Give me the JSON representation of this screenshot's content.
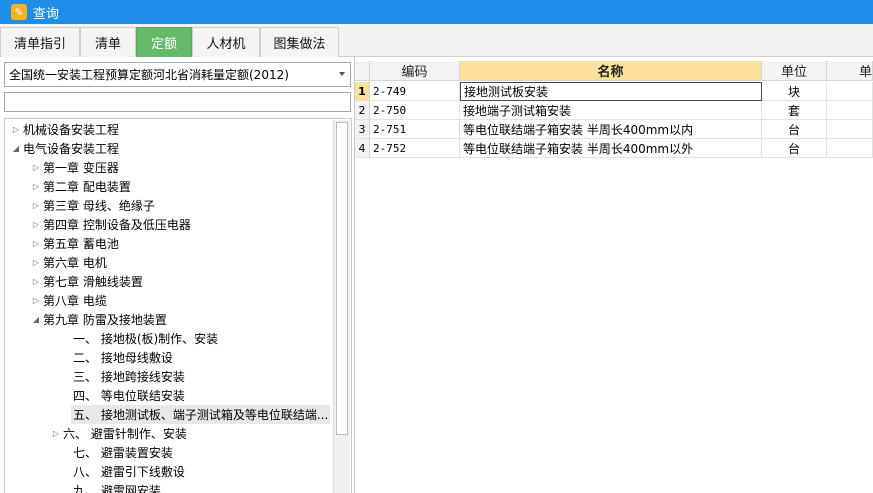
{
  "window": {
    "title": "查询"
  },
  "tabs": [
    {
      "label": "清单指引",
      "active": false
    },
    {
      "label": "清单",
      "active": false
    },
    {
      "label": "定额",
      "active": true
    },
    {
      "label": "人材机",
      "active": false
    },
    {
      "label": "图集做法",
      "active": false
    }
  ],
  "left_panel": {
    "quota_library": "全国统一安装工程预算定额河北省消耗量定额(2012)",
    "search_value": ""
  },
  "tree": [
    {
      "label": "机械设备安装工程",
      "state": "collapsed"
    },
    {
      "label": "电气设备安装工程",
      "state": "expanded"
    },
    {
      "label": "第一章 变压器",
      "state": "collapsed"
    },
    {
      "label": "第二章 配电装置",
      "state": "collapsed"
    },
    {
      "label": "第三章 母线、绝缘子",
      "state": "collapsed"
    },
    {
      "label": "第四章 控制设备及低压电器",
      "state": "collapsed"
    },
    {
      "label": "第五章 蓄电池",
      "state": "collapsed"
    },
    {
      "label": "第六章 电机",
      "state": "collapsed"
    },
    {
      "label": "第七章 滑触线装置",
      "state": "collapsed"
    },
    {
      "label": "第八章 电缆",
      "state": "collapsed"
    },
    {
      "label": "第九章 防雷及接地装置",
      "state": "expanded"
    },
    {
      "label": "一、 接地极(板)制作、安装",
      "state": "leaf"
    },
    {
      "label": "二、 接地母线敷设",
      "state": "leaf"
    },
    {
      "label": "三、 接地跨接线安装",
      "state": "leaf"
    },
    {
      "label": "四、 等电位联结安装",
      "state": "leaf"
    },
    {
      "label": "五、 接地测试板、端子测试箱及等电位联结端...",
      "state": "leaf",
      "selected": true
    },
    {
      "label": "六、 避雷针制作、安装",
      "state": "collapsed"
    },
    {
      "label": "七、 避雷装置安装",
      "state": "leaf"
    },
    {
      "label": "八、 避雷引下线敷设",
      "state": "leaf"
    },
    {
      "label": "九、 避雷网安装",
      "state": "leaf"
    }
  ],
  "grid": {
    "columns": [
      "编码",
      "名称",
      "单位",
      "单"
    ],
    "rows": [
      {
        "num": "1",
        "code": "2-749",
        "name": "接地测试板安装",
        "unit": "块"
      },
      {
        "num": "2",
        "code": "2-750",
        "name": "接地端子测试箱安装",
        "unit": "套"
      },
      {
        "num": "3",
        "code": "2-751",
        "name": "等电位联结端子箱安装 半周长400mm以内",
        "unit": "台"
      },
      {
        "num": "4",
        "code": "2-752",
        "name": "等电位联结端子箱安装 半周长400mm以外",
        "unit": "台"
      }
    ]
  }
}
